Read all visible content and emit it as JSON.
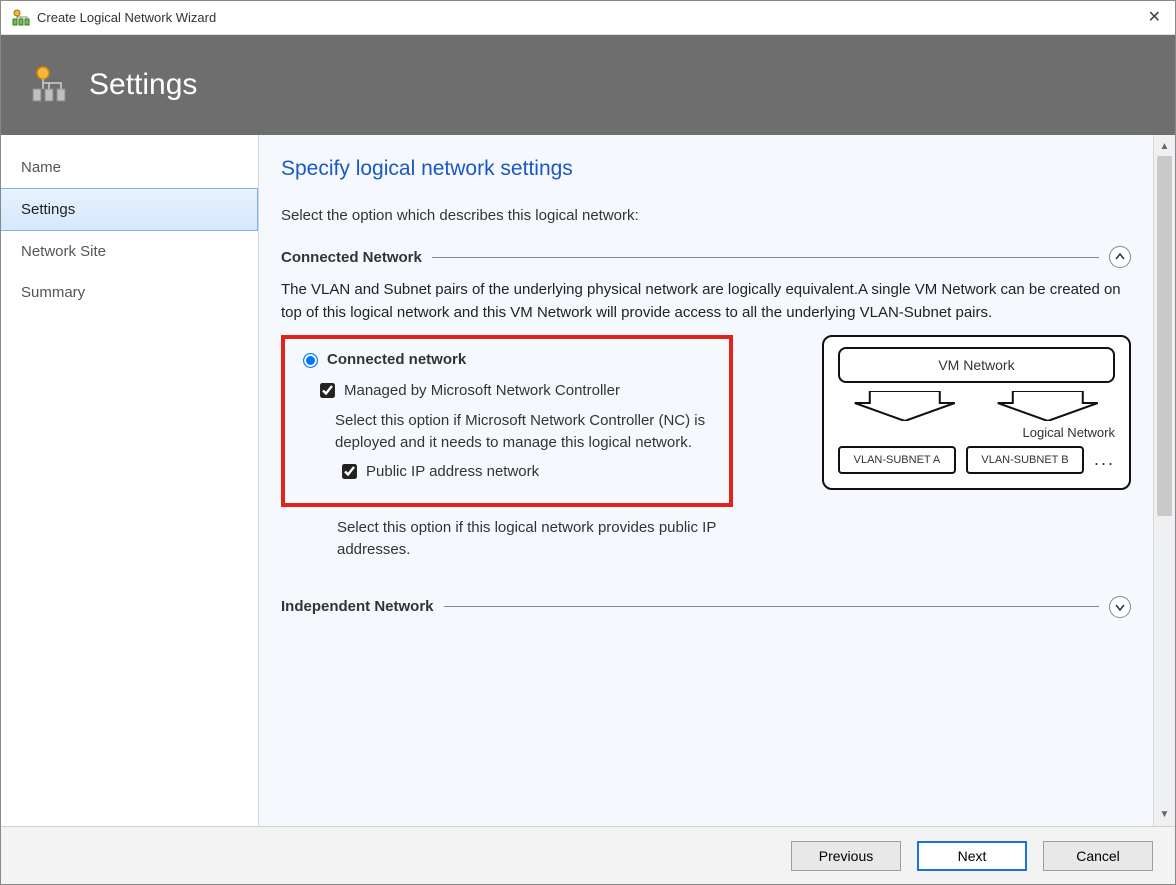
{
  "window": {
    "title": "Create Logical Network Wizard",
    "close_glyph": "✕"
  },
  "header": {
    "title": "Settings"
  },
  "sidebar": {
    "items": [
      {
        "label": "Name"
      },
      {
        "label": "Settings"
      },
      {
        "label": "Network Site"
      },
      {
        "label": "Summary"
      }
    ],
    "active_index": 1
  },
  "main": {
    "heading": "Specify logical network settings",
    "intro": "Select the option which describes this logical network:",
    "section1": {
      "title": "Connected Network",
      "description": "The VLAN and Subnet pairs of the underlying physical network are logically equivalent.A single VM Network can be created on top of this logical network and this VM Network will provide access to all the underlying VLAN-Subnet pairs.",
      "radio_label": "Connected network",
      "checkbox1_label": "Managed by Microsoft Network Controller",
      "checkbox1_desc": "Select this option if Microsoft Network Controller (NC) is deployed and it needs to manage this logical network.",
      "checkbox2_label": "Public IP address network",
      "checkbox2_desc": "Select this option if this logical network provides public IP addresses."
    },
    "section2": {
      "title": "Independent Network"
    },
    "diagram": {
      "vm_label": "VM Network",
      "logical_label": "Logical  Network",
      "vlan_a": "VLAN-SUBNET A",
      "vlan_b": "VLAN-SUBNET B",
      "dots": "..."
    }
  },
  "footer": {
    "previous": "Previous",
    "next": "Next",
    "cancel": "Cancel"
  }
}
